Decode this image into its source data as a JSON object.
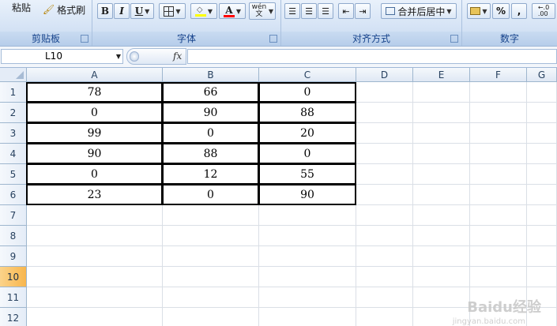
{
  "ribbon": {
    "clipboard": {
      "paste_label": "粘贴",
      "format_painter_label": "格式刷",
      "group_label": "剪贴板"
    },
    "font": {
      "bold_label": "B",
      "italic_label": "I",
      "underline_label": "U",
      "phonetic_label": "wén 文",
      "font_color": "#ff0000",
      "fill_color": "#ffff00",
      "group_label": "字体"
    },
    "alignment": {
      "merge_center_label": "合并后居中",
      "group_label": "对齐方式"
    },
    "number": {
      "percent_label": "%",
      "comma_label": ",",
      "group_label": "数字"
    }
  },
  "formula_bar": {
    "name_box_value": "L10",
    "fx_label": "fx",
    "formula_value": ""
  },
  "sheet": {
    "columns": [
      "A",
      "B",
      "C",
      "D",
      "E",
      "F",
      "G"
    ],
    "rows": [
      "1",
      "2",
      "3",
      "4",
      "5",
      "6",
      "7",
      "8",
      "9",
      "10",
      "11",
      "12"
    ],
    "active_row": "10",
    "data": [
      [
        "78",
        "66",
        "0"
      ],
      [
        "0",
        "90",
        "88"
      ],
      [
        "99",
        "0",
        "20"
      ],
      [
        "90",
        "88",
        "0"
      ],
      [
        "0",
        "12",
        "55"
      ],
      [
        "23",
        "0",
        "90"
      ]
    ]
  },
  "watermark": {
    "text": "Baidu经验",
    "subtext": "jingyan.baidu.com"
  }
}
